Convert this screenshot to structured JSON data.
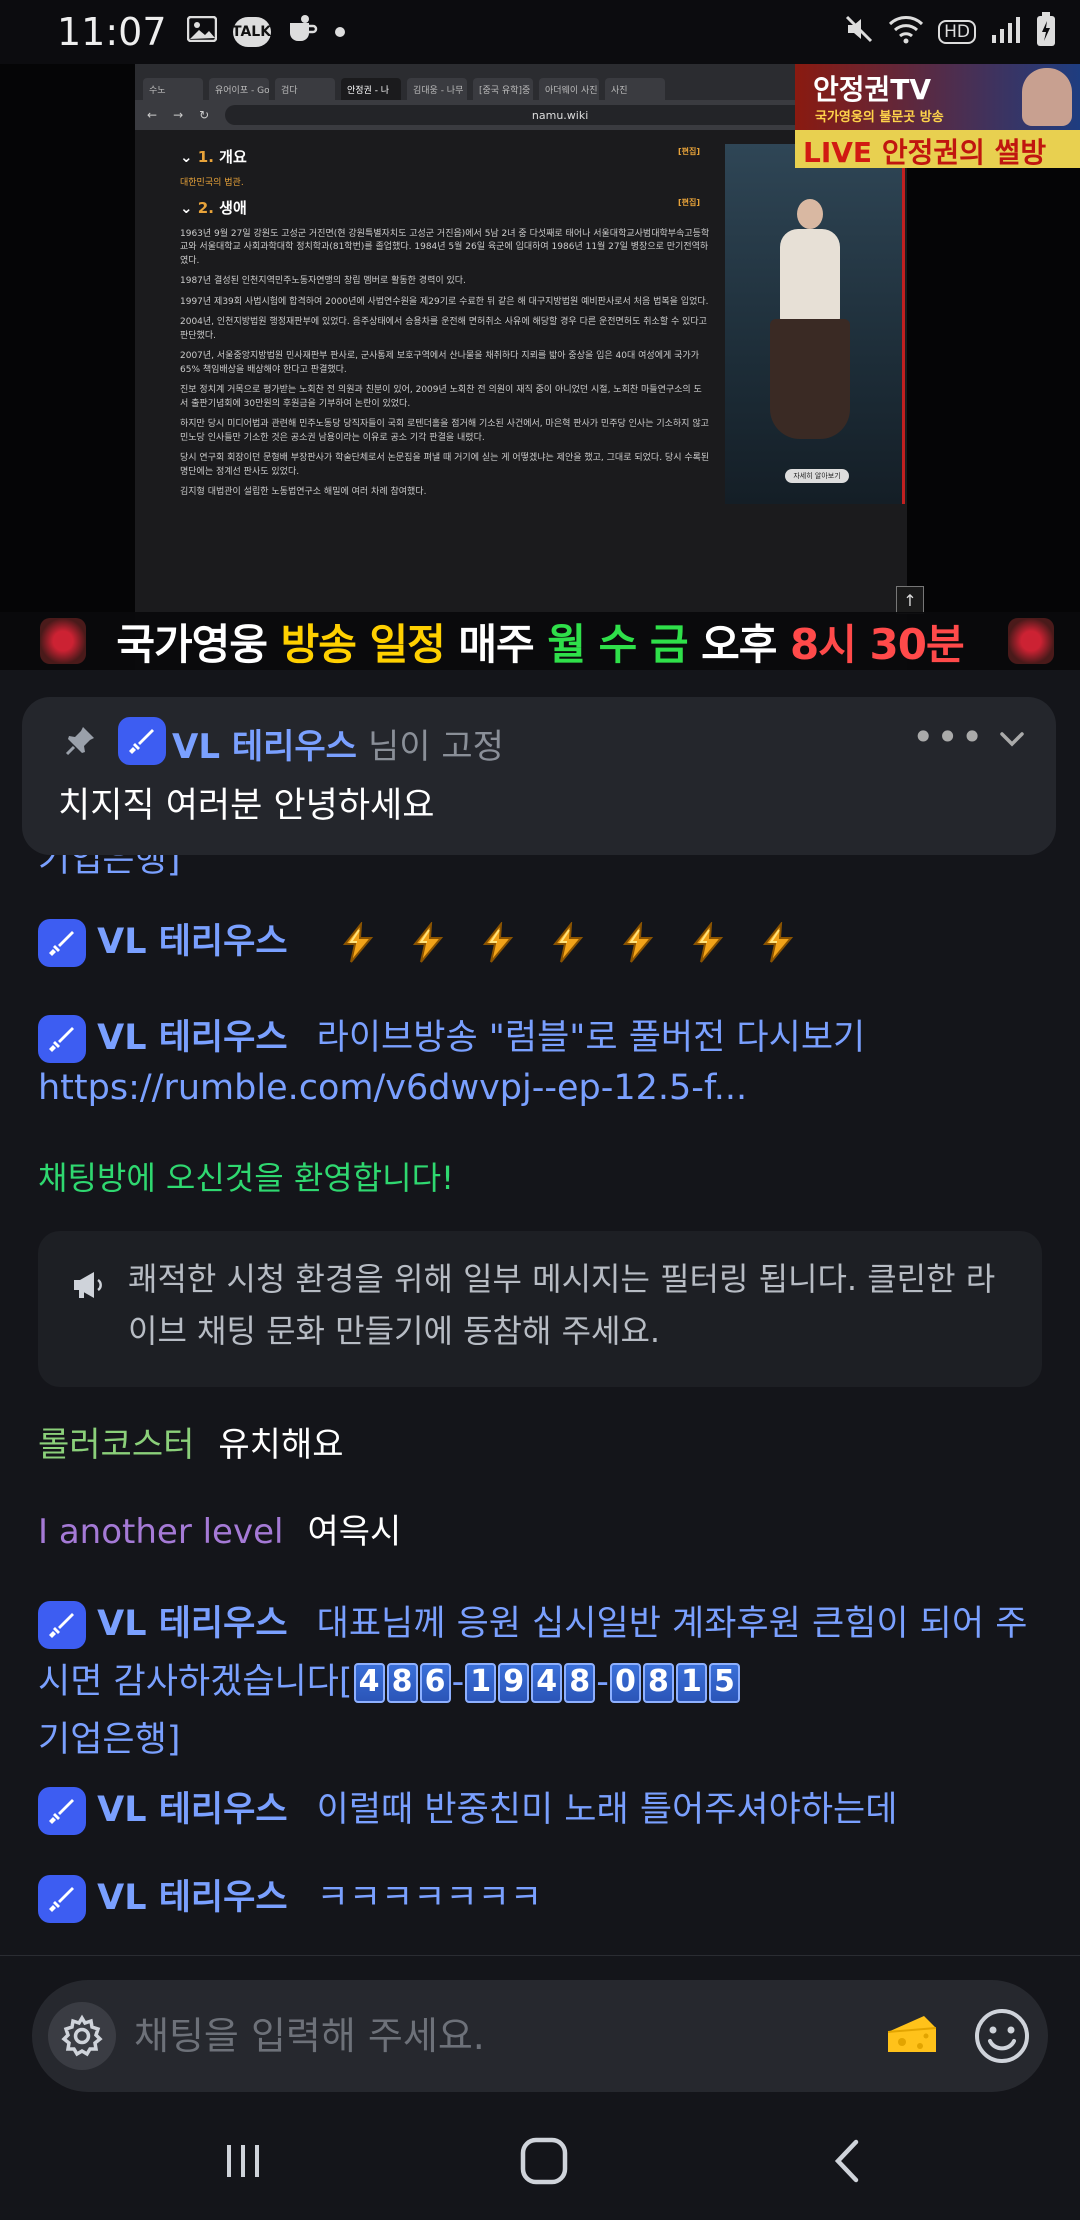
{
  "status_bar": {
    "time": "11:07",
    "talk_badge": "TALK",
    "hd_badge": "HD",
    "icons_left": [
      "gallery-icon",
      "talk-icon",
      "coffee-icon",
      "dot-icon"
    ],
    "icons_right": [
      "mute-icon",
      "wifi-icon",
      "hd-icon",
      "signal-icon",
      "battery-charging-icon"
    ]
  },
  "video": {
    "browser_url": "namu.wiki",
    "browser_tabs": [
      "수노",
      "유어이포 - Go",
      "검다",
      "안정권 - 나",
      "김대웅 - 나무",
      "[중국 유학]중",
      "아더웨이 사진",
      "사진"
    ],
    "wiki_sections": [
      {
        "num": "1.",
        "title": "개요"
      },
      {
        "num": "2.",
        "title": "생애"
      }
    ],
    "wiki_edit": "[편집]",
    "wiki_intro": "대한민국의 법관.",
    "wiki_lines": [
      "1963년 9월 27일 강원도 고성군 거진면(현 강원특별자치도 고성군 거진읍)에서 5남 2녀 중 다섯째로 태어나 서울대학교사범대학부속고등학교와 서울대학교 사회과학대학 정치학과(81학번)를 졸업했다. 1984년 5월 26일 육군에 입대하여 1986년 11월 27일 병장으로 만기전역하였다.",
      "1987년 결성된 인천지역민주노동자연맹의 창립 멤버로 활동한 경력이 있다.",
      "1997년 제39회 사법시험에 합격하여 2000년에 사법연수원을 제29기로 수료한 뒤 같은 해 대구지방법원 예비판사로서 처음 법복을 입었다.",
      "2004년, 인천지방법원 행정재판부에 있었다. 음주상태에서 승용차를 운전해 면허취소 사유에 해당할 경우 다른 운전면허도 취소할 수 있다고 판단했다.",
      "2007년, 서울중앙지방법원 민사재판부 판사로, 군사통제 보호구역에서 산나물을 채취하다 지뢰를 밟아 중상을 입은 40대 여성에게 국가가 65% 책임배상을 배상해야 한다고 판결했다.",
      "진보 정치계 거목으로 평가받는 노회찬 전 의원과 친분이 있어, 2009년 노회찬 전 의원이 재직 중이 아니었던 시절, 노회찬 마들연구소의 도서 출판기념회에 30만원의 후원금을 기부하여 논란이 있었다.",
      "하지만 당시 미디어법과 관련해 민주노동당 당직자들이 국회 로텐더홀을 점거해 기소된 사건에서, 마은혁 판사가 민주당 인사는 기소하지 않고 민노당 인사들만 기소한 것은 공소권 남용이라는 이유로 공소 기각 판결을 내렸다.",
      "당시 연구회 회장이던 문형배 부장판사가 학술단체로서 논문집을 펴낼 때 거기에 싣는 게 어떻겠냐는 제안을 했고, 그대로 되었다. 당시 수록된 명단에는 정계선 판사도 있었다.",
      "김지형 대법관이 설립한 노동법연구소 해밀에 여러 차례 참여했다."
    ],
    "ad_button": "자세히 알아보기",
    "channel_logo_title": "안정권TV",
    "channel_logo_sub": "국가영웅의 불문곳 방송",
    "channel_logo_live_prefix": "LIVE",
    "channel_logo_live_name": "안정권의 썰방",
    "ticker": [
      {
        "text": "국가영웅 ",
        "color": "white"
      },
      {
        "text": "방송 일정 ",
        "color": "yellow"
      },
      {
        "text": "매주 ",
        "color": "white"
      },
      {
        "text": "월 수 금 ",
        "color": "green"
      },
      {
        "text": "오후 ",
        "color": "white"
      },
      {
        "text": "8시 30분",
        "color": "red"
      }
    ]
  },
  "pinned": {
    "author": "VL 테리우스",
    "suffix": "님이 고정",
    "text": "치지직 여러분 안녕하세요",
    "more": "•••"
  },
  "chat": {
    "cut_top": "기업은행]",
    "messages": [
      {
        "author": "VL 테리우스",
        "type": "emotes",
        "emote_count": 7
      },
      {
        "author": "VL 테리우스",
        "text": "라이브방송 \"럼블\"로 풀버전 다시보기https://rumble.com/v6dwvpj--ep-12.5-f..."
      },
      {
        "welcome": "채팅방에 오신것을 환영합니다!"
      },
      {
        "notice": "쾌적한 시청 환경을 위해 일부 메시지는 필터링 됩니다. 클린한 라이브 채팅 문화 만들기에 동참해 주세요."
      },
      {
        "author": "롤러코스터",
        "text": "유치해요",
        "color": "green"
      },
      {
        "author": "I another level",
        "text": "여윽시",
        "color": "purple"
      },
      {
        "author": "VL 테리우스",
        "text_before": "대표님께 응원 십시일반 계좌후원 큰힘이 되어 주시면 감사하겠습니다[",
        "account": [
          "486",
          "1948",
          "0815"
        ],
        "text_after": "기업은행]"
      },
      {
        "author": "VL 테리우스",
        "text": "이럴때 반중친미 노래 틀어주셔야하는데"
      },
      {
        "author": "VL 테리우스",
        "text": "ㅋㅋㅋㅋㅋㅋㅋ"
      }
    ]
  },
  "input": {
    "placeholder": "채팅을 입력해 주세요."
  },
  "colors": {
    "background": "#14151a",
    "author_blue": "#7aa0ff",
    "badge_blue": "#3d5df2",
    "welcome_green": "#2fd870",
    "user_green": "#8bd07a",
    "user_purple": "#a57ad6"
  }
}
